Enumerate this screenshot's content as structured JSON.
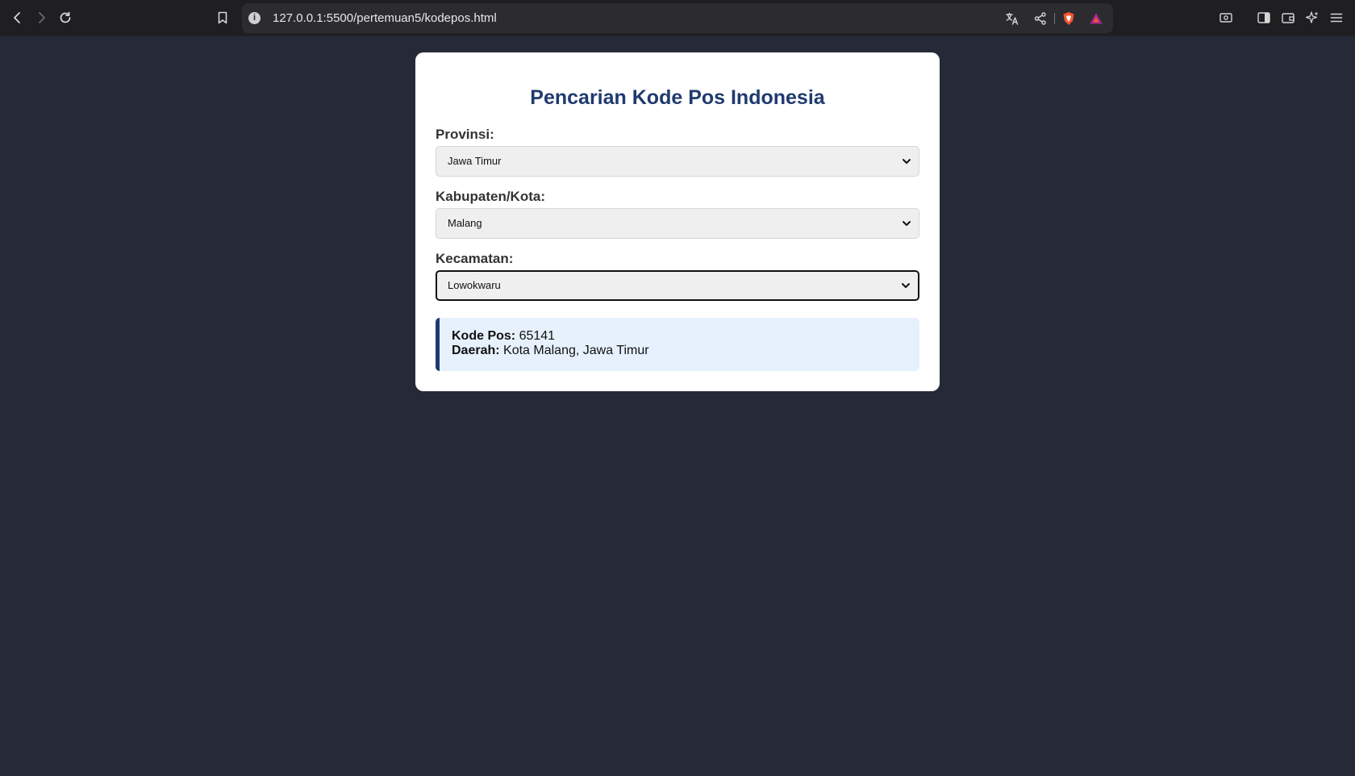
{
  "browser": {
    "url": "127.0.0.1:5500/pertemuan5/kodepos.html",
    "icons": [
      "back-icon",
      "forward-icon",
      "reload-icon",
      "bookmark-icon",
      "site-info-icon",
      "translate-icon",
      "share-icon",
      "brave-shield-icon",
      "brave-rewards-icon",
      "reader-mode-icon",
      "sidebar-icon",
      "wallet-icon",
      "leo-ai-icon",
      "menu-icon"
    ],
    "info_glyph": "i"
  },
  "page": {
    "title": "Pencarian Kode Pos Indonesia",
    "provinsi": {
      "label": "Provinsi:",
      "value": "Jawa Timur"
    },
    "kabupaten": {
      "label": "Kabupaten/Kota:",
      "value": "Malang"
    },
    "kecamatan": {
      "label": "Kecamatan:",
      "value": "Lowokwaru"
    },
    "result": {
      "kode_pos_label": "Kode Pos:",
      "kode_pos_value": "65141",
      "daerah_label": "Daerah:",
      "daerah_value": "Kota Malang, Jawa Timur"
    }
  },
  "colors": {
    "page_bg": "#252a36",
    "title": "#1f3a6e",
    "result_bg": "#e6f1fd",
    "result_accent": "#1f3a6e"
  }
}
